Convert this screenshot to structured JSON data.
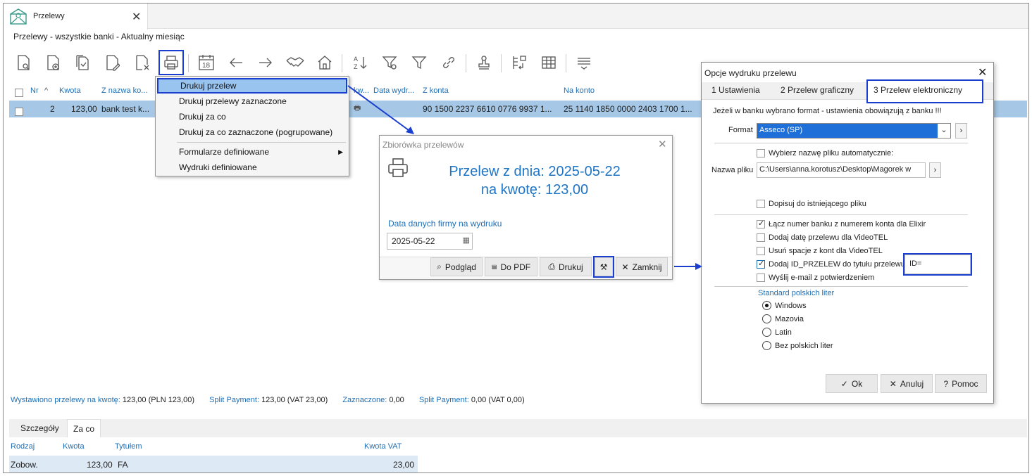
{
  "window": {
    "tab_title": "Przelewy",
    "breadcrumb": "Przelewy - wszystkie banki - Aktualny miesiąc"
  },
  "toolbar": {
    "calendar_day": "18",
    "sort_label_top": "A",
    "sort_label_bottom": "Z"
  },
  "grid": {
    "headers": {
      "nr": "Nr",
      "kwota": "Kwota",
      "z_nazwa": "Z nazwa ko...",
      "ekw": "kw...",
      "data_wydr": "Data wydr...",
      "z_konta": "Z konta",
      "na_konto": "Na konto"
    },
    "row": {
      "nr": "2",
      "kwota": "123,00",
      "z_nazwa": "bank test k...",
      "z_konta": "90 1500 2237 6610 0776 9937 1...",
      "na_konto": "25 1140 1850 0000 2403 1700 1..."
    }
  },
  "context_menu": {
    "items": [
      "Drukuj przelew",
      "Drukuj przelewy zaznaczone",
      "Drukuj za co",
      "Drukuj za co zaznaczone (pogrupowane)",
      "Formularze definiowane",
      "Wydruki definiowane"
    ]
  },
  "dialog_zbiorowka": {
    "title": "Zbiorówka przelewów",
    "line1": "Przelew z dnia: 2025-05-22",
    "line2": "na kwotę: 123,00",
    "date_label": "Data danych firmy na wydruku",
    "date_value": "2025-05-22",
    "buttons": {
      "podglad": "Podgląd",
      "pdf": "Do PDF",
      "drukuj": "Drukuj",
      "zamknij": "Zamknij"
    }
  },
  "dialog_opcje": {
    "title": "Opcje wydruku przelewu",
    "tabs": [
      "1 Ustawienia",
      "2 Przelew graficzny",
      "3 Przelew elektroniczny"
    ],
    "info": "Jeżeli w banku wybrano format - ustawienia obowiązują z banku !!!",
    "format_label": "Format",
    "format_value": "Asseco (SP)",
    "auto_name": "Wybierz nazwę pliku automatycznie:",
    "file_label": "Nazwa pliku",
    "file_value": "C:\\Users\\anna.korotusz\\Desktop\\Magorek w",
    "append": "Dopisuj do istniejącego pliku",
    "opt_elixir": "Łącz numer banku z numerem konta dla Elixir",
    "opt_videotel_date": "Dodaj datę przelewu dla VideoTEL",
    "opt_videotel_spaces": "Usuń spacje z kont dla VideoTEL",
    "opt_id": "Dodaj ID_PRZELEW do tytułu przelewu",
    "id_value": "ID=",
    "opt_email": "Wyślij e-mail z potwierdzeniem",
    "standard_label": "Standard polskich liter",
    "radios": [
      "Windows",
      "Mazovia",
      "Latin",
      "Bez polskich liter"
    ],
    "buttons": {
      "ok": "Ok",
      "anuluj": "Anuluj",
      "pomoc": "Pomoc"
    }
  },
  "status": {
    "wystawiono_label": "Wystawiono przelewy na kwotę:",
    "wystawiono_val": "123,00  (PLN 123,00)",
    "split_label": "Split Payment:",
    "split_val": "123,00  (VAT 23,00)",
    "zazn_label": "Zaznaczone:",
    "zazn_val": "0,00",
    "split2_label": "Split Payment:",
    "split2_val": "0,00  (VAT 0,00)"
  },
  "bottom": {
    "tabs": [
      "Szczegóły",
      "Za co"
    ],
    "headers": {
      "rodzaj": "Rodzaj",
      "kwota": "Kwota",
      "tytulem": "Tytułem",
      "kwota_vat": "Kwota VAT"
    },
    "row": {
      "rodzaj": "Zobow.",
      "kwota": "123,00",
      "tytulem": "FA",
      "kwota_vat": "23,00"
    }
  },
  "colors": {
    "accent": "#1f75c4",
    "highlight_border": "#1a3fcf",
    "selection": "#a6c8e6"
  }
}
